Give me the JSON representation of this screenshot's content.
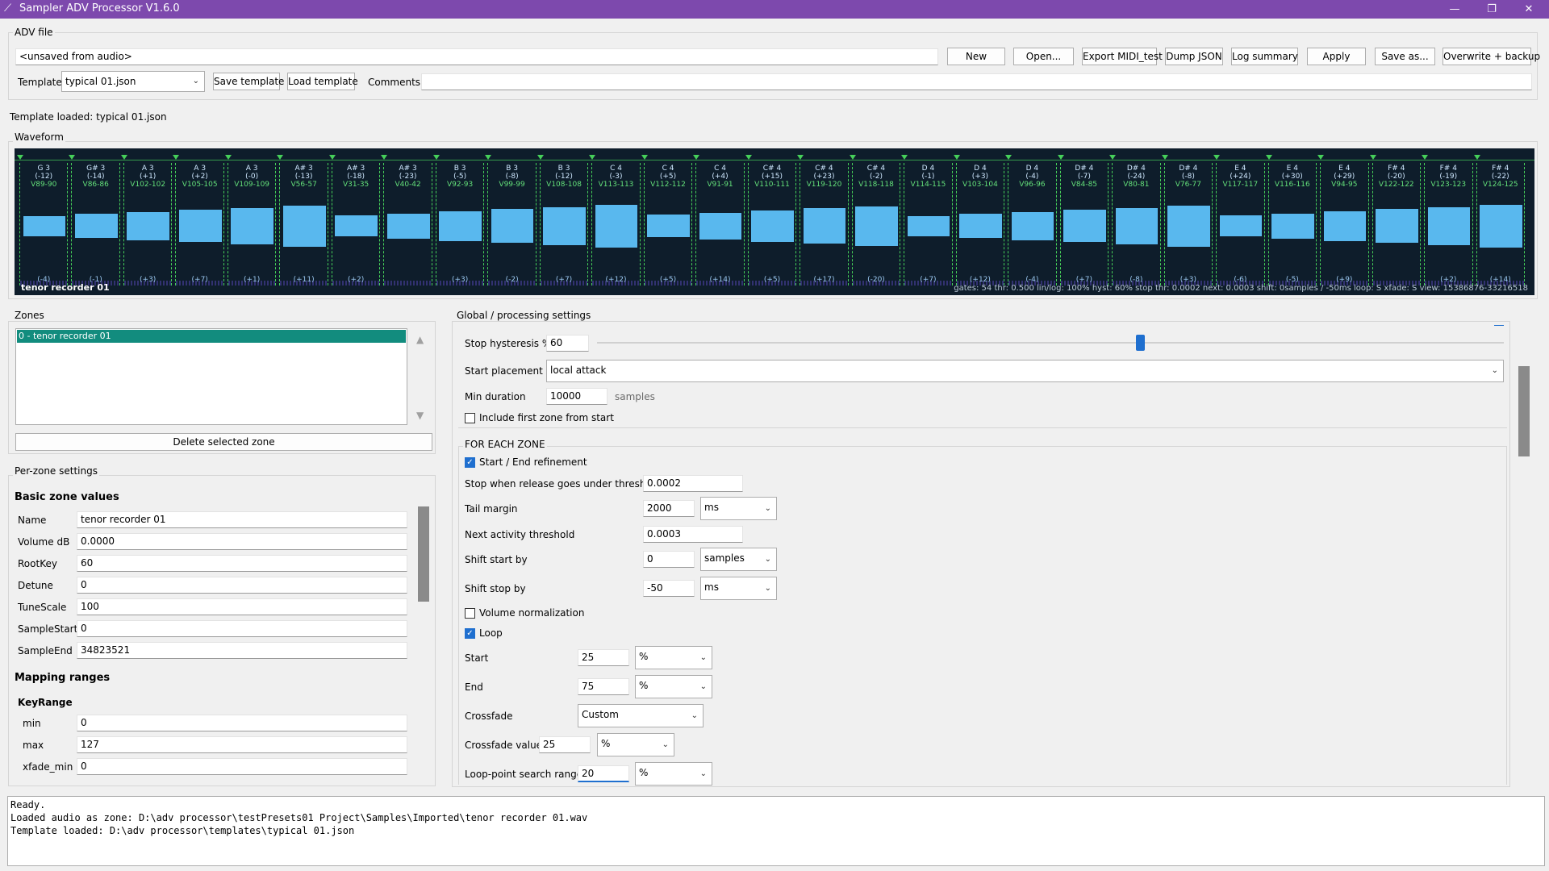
{
  "window": {
    "title": "Sampler ADV Processor V1.6.0",
    "minimize": "—",
    "restore": "❐",
    "close": "✕",
    "accent": "#7d49ad"
  },
  "adv_file": {
    "group_label": "ADV file",
    "path": "<unsaved from audio>",
    "buttons": [
      "New",
      "Open...",
      "Export MIDI_test",
      "Dump JSON",
      "Log summary",
      "Apply",
      "Save as...",
      "Overwrite + backup"
    ],
    "template_label": "Template",
    "template_value": "typical 01.json",
    "save_template": "Save template",
    "load_template": "Load template",
    "comments_label": "Comments",
    "comments_value": ""
  },
  "status_line": "Template loaded: typical 01.json",
  "waveform": {
    "group_label": "Waveform",
    "title": "tenor recorder 01",
    "status": "gates: 54  thr: 0.500  lin/log: 100%  hyst: 60%  stop thr: 0.0002  next: 0.0003  shift: 0samples / -50ms  loop: S  xfade: S  view: 15386876-33216518",
    "zones": [
      {
        "note": "G 3",
        "off": "(-12)",
        "vel": "V89-90",
        "bot": "(-4)"
      },
      {
        "note": "G# 3",
        "off": "(-14)",
        "vel": "V86-86",
        "bot": "(-1)"
      },
      {
        "note": "A 3",
        "off": "(+1)",
        "vel": "V102-102",
        "bot": "(+3)"
      },
      {
        "note": "A 3",
        "off": "(+2)",
        "vel": "V105-105",
        "bot": "(+7)"
      },
      {
        "note": "A 3",
        "off": "(-0)",
        "vel": "V109-109",
        "bot": "(+1)"
      },
      {
        "note": "A# 3",
        "off": "(-13)",
        "vel": "V56-57",
        "bot": "(+11)"
      },
      {
        "note": "A# 3",
        "off": "(-18)",
        "vel": "V31-35",
        "bot": "(+2)"
      },
      {
        "note": "A# 3",
        "off": "(-23)",
        "vel": "V40-42",
        "bot": ""
      },
      {
        "note": "B 3",
        "off": "(-5)",
        "vel": "V92-93",
        "bot": "(+3)"
      },
      {
        "note": "B 3",
        "off": "(-8)",
        "vel": "V99-99",
        "bot": "(-2)"
      },
      {
        "note": "B 3",
        "off": "(-12)",
        "vel": "V108-108",
        "bot": "(+7)"
      },
      {
        "note": "C 4",
        "off": "(-3)",
        "vel": "V113-113",
        "bot": "(+12)"
      },
      {
        "note": "C 4",
        "off": "(+5)",
        "vel": "V112-112",
        "bot": "(+5)"
      },
      {
        "note": "C 4",
        "off": "(+4)",
        "vel": "V91-91",
        "bot": "(+14)"
      },
      {
        "note": "C# 4",
        "off": "(+15)",
        "vel": "V110-111",
        "bot": "(+5)"
      },
      {
        "note": "C# 4",
        "off": "(+23)",
        "vel": "V119-120",
        "bot": "(+17)"
      },
      {
        "note": "C# 4",
        "off": "(-2)",
        "vel": "V118-118",
        "bot": "(-20)"
      },
      {
        "note": "D 4",
        "off": "(-1)",
        "vel": "V114-115",
        "bot": "(+7)"
      },
      {
        "note": "D 4",
        "off": "(+3)",
        "vel": "V103-104",
        "bot": "(+12)"
      },
      {
        "note": "D 4",
        "off": "(-4)",
        "vel": "V96-96",
        "bot": "(-4)"
      },
      {
        "note": "D# 4",
        "off": "(-7)",
        "vel": "V84-85",
        "bot": "(+7)"
      },
      {
        "note": "D# 4",
        "off": "(-24)",
        "vel": "V80-81",
        "bot": "(-8)"
      },
      {
        "note": "D# 4",
        "off": "(-8)",
        "vel": "V76-77",
        "bot": "(+3)"
      },
      {
        "note": "E 4",
        "off": "(+24)",
        "vel": "V117-117",
        "bot": "(-6)"
      },
      {
        "note": "E 4",
        "off": "(+30)",
        "vel": "V116-116",
        "bot": "(-5)"
      },
      {
        "note": "E 4",
        "off": "(+29)",
        "vel": "V94-95",
        "bot": "(+9)"
      },
      {
        "note": "F# 4",
        "off": "(-20)",
        "vel": "V122-122",
        "bot": ""
      },
      {
        "note": "F# 4",
        "off": "(-19)",
        "vel": "V123-123",
        "bot": "(+2)"
      },
      {
        "note": "F# 4",
        "off": "(-22)",
        "vel": "V124-125",
        "bot": "(+14)"
      }
    ]
  },
  "zones_panel": {
    "group_label": "Zones",
    "items": [
      "0 - tenor recorder 01"
    ],
    "delete_button": "Delete selected zone"
  },
  "per_zone": {
    "group_label": "Per-zone settings",
    "basic_header": "Basic zone values",
    "fields": [
      {
        "label": "Name",
        "value": "tenor recorder 01"
      },
      {
        "label": "Volume dB",
        "value": "0.0000"
      },
      {
        "label": "RootKey",
        "value": "60"
      },
      {
        "label": "Detune",
        "value": "0"
      },
      {
        "label": "TuneScale",
        "value": "100"
      },
      {
        "label": "SampleStart",
        "value": "0"
      },
      {
        "label": "SampleEnd",
        "value": "34823521"
      }
    ],
    "mapping_header": "Mapping ranges",
    "keyrange_header": "KeyRange",
    "keyrange": [
      {
        "label": "min",
        "value": "0"
      },
      {
        "label": "max",
        "value": "127"
      },
      {
        "label": "xfade_min",
        "value": "0"
      }
    ]
  },
  "global": {
    "group_label": "Global / processing settings",
    "stop_hysteresis_label": "Stop hysteresis %",
    "stop_hysteresis_value": "60",
    "stop_hysteresis_fraction": 0.6,
    "start_placement_label": "Start placement",
    "start_placement_value": "local attack",
    "min_duration_label": "Min duration",
    "min_duration_value": "10000",
    "min_duration_unit": "samples",
    "include_first_label": "Include first zone from start",
    "include_first_checked": false,
    "for_each_zone_label": "FOR EACH ZONE",
    "refinement_label": "Start / End refinement",
    "refinement_checked": true,
    "stop_release_label": "Stop when release goes under threshold",
    "stop_release_value": "0.0002",
    "tail_margin_label": "Tail margin",
    "tail_margin_value": "2000",
    "tail_margin_unit": "ms",
    "next_activity_label": "Next activity threshold",
    "next_activity_value": "0.0003",
    "shift_start_label": "Shift start by",
    "shift_start_value": "0",
    "shift_start_unit": "samples",
    "shift_stop_label": "Shift stop by",
    "shift_stop_value": "-50",
    "shift_stop_unit": "ms",
    "volume_norm_label": "Volume normalization",
    "volume_norm_checked": false,
    "loop_label": "Loop",
    "loop_checked": true,
    "loop_start_label": "Start",
    "loop_start_value": "25",
    "loop_start_unit": "%",
    "loop_end_label": "End",
    "loop_end_value": "75",
    "loop_end_unit": "%",
    "crossfade_label": "Crossfade",
    "crossfade_value": "Custom",
    "crossfade_value_label": "Crossfade value",
    "crossfade_value_value": "25",
    "crossfade_value_unit": "%",
    "loop_search_label": "Loop-point search range",
    "loop_search_value": "20",
    "loop_search_unit": "%"
  },
  "log": {
    "lines": [
      "Ready.",
      "Loaded audio as zone: D:\\adv processor\\testPresets01 Project\\Samples\\Imported\\tenor recorder 01.wav",
      "Template loaded: D:\\adv processor\\templates\\typical 01.json"
    ]
  }
}
